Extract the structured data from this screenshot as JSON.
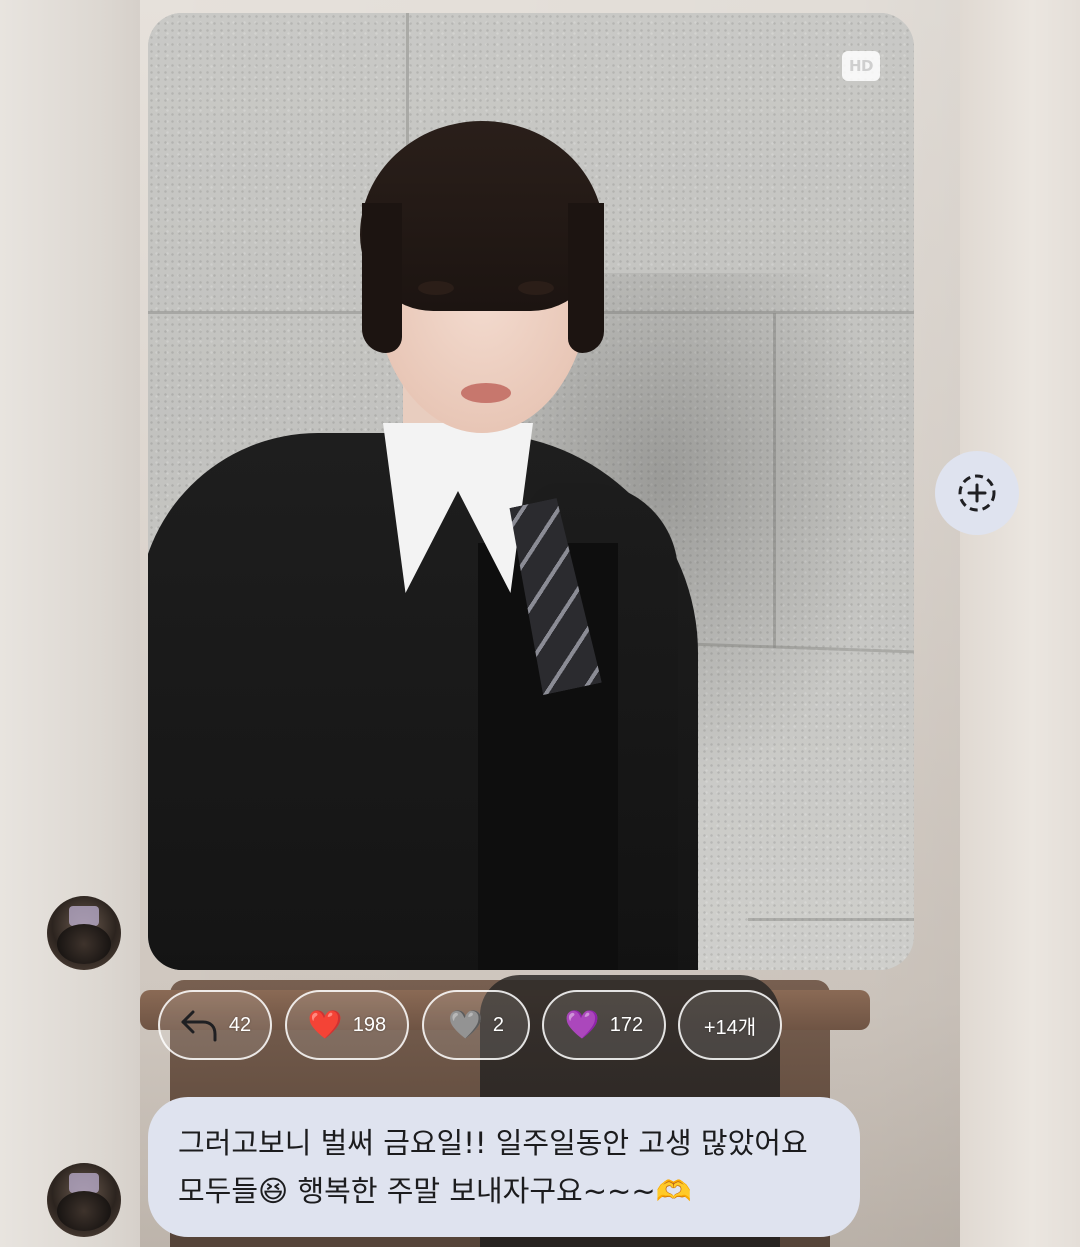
{
  "photo": {
    "badge": "HD",
    "description_icon": "photo-of-person-in-suit"
  },
  "save_button": {
    "icon": "save-plus-icon"
  },
  "reactions": [
    {
      "icon": "reply-icon",
      "emoji": "",
      "count": "42"
    },
    {
      "icon": "red-heart-icon",
      "emoji": "❤️",
      "count": "198"
    },
    {
      "icon": "grey-heart-icon",
      "emoji": "🩶",
      "count": "2"
    },
    {
      "icon": "purple-heart-icon",
      "emoji": "💜",
      "count": "172"
    },
    {
      "icon": "more-reactions",
      "emoji": "",
      "count": "+14개"
    }
  ],
  "message": {
    "line1": "그러고보니 벌써 금요일!! 일주일동안 고생 많았어요",
    "line2": "모두들😆 행복한 주말 보내자구요~~~🫶"
  },
  "colors": {
    "bubble_bg": "#dfe3ef",
    "text": "#1c1c1e",
    "chip_border": "#ffffff"
  }
}
